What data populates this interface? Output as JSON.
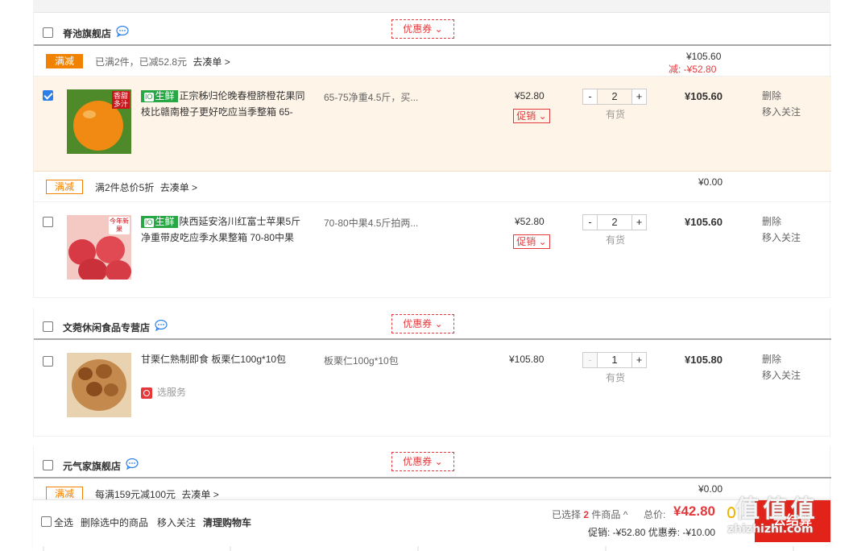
{
  "shops": [
    {
      "name": "脊池旗舰店",
      "coupon": "优惠券",
      "groups": [
        {
          "tag": "满减",
          "promo_text": "已满2件，已减52.8元",
          "promo_link": "去凑单 >",
          "total": "¥105.60",
          "discount": "减: -¥52.80",
          "items": [
            {
              "checked": true,
              "fresh": "生鲜",
              "title": "正宗秭归伦晚春橙脐橙花果同枝比赣南橙子更好吃应当季整箱 65-",
              "spec": "65-75净重4.5斤，买...",
              "price": "¥52.80",
              "promo": "促销",
              "qty": "2",
              "stock": "有货",
              "sum": "¥105.60",
              "thumb_badge": "香甜多汁",
              "thumb_color": "#f08a12"
            }
          ]
        },
        {
          "tag": "满减",
          "promo_text": "满2件总价5折",
          "promo_link": "去凑单 >",
          "total": "¥0.00",
          "items": [
            {
              "checked": false,
              "fresh": "生鲜",
              "title": "陕西延安洛川红富士苹果5斤净重带皮吃应季水果整箱 70-80中果",
              "spec": "70-80中果4.5斤拍两...",
              "price": "¥52.80",
              "promo": "促销",
              "qty": "2",
              "stock": "有货",
              "sum": "¥105.60",
              "thumb_badge": "今年新果",
              "thumb_color": "#e0454f"
            }
          ]
        }
      ]
    },
    {
      "name": "文菀休闲食品专营店",
      "coupon": "优惠券",
      "items": [
        {
          "checked": false,
          "title": "甘栗仁熟制即食 板栗仁100g*10包",
          "spec": "板栗仁100g*10包",
          "price": "¥105.80",
          "qty": "1",
          "stock": "有货",
          "sum": "¥105.80",
          "service": "选服务",
          "thumb_color": "#a5602a"
        }
      ]
    },
    {
      "name": "元气家旗舰店",
      "coupon": "优惠券",
      "group": {
        "tag": "满减",
        "promo_text": "每满159元减100元",
        "promo_link": "去凑单 >",
        "total": "¥0.00"
      }
    }
  ],
  "ops": {
    "delete": "删除",
    "follow": "移入关注"
  },
  "footer": {
    "select_all": "全选",
    "delete_selected": "删除选中的商品",
    "move_follow": "移入关注",
    "clear_cart": "清理购物车",
    "selected_prefix": "已选择",
    "selected_count": "2",
    "selected_suffix": "件商品",
    "total_label": "总价:",
    "total": "¥42.80",
    "breakdown": "促销: -¥52.80 优惠券: -¥10.00",
    "checkout": "去结算"
  },
  "watermark": {
    "title": "值 值 值",
    "url": "zhizhizhi.com"
  },
  "colors": {
    "accent": "#e4393c",
    "orange": "#f08200",
    "fresh": "#28a745",
    "row_highlight": "#fff4e8"
  }
}
